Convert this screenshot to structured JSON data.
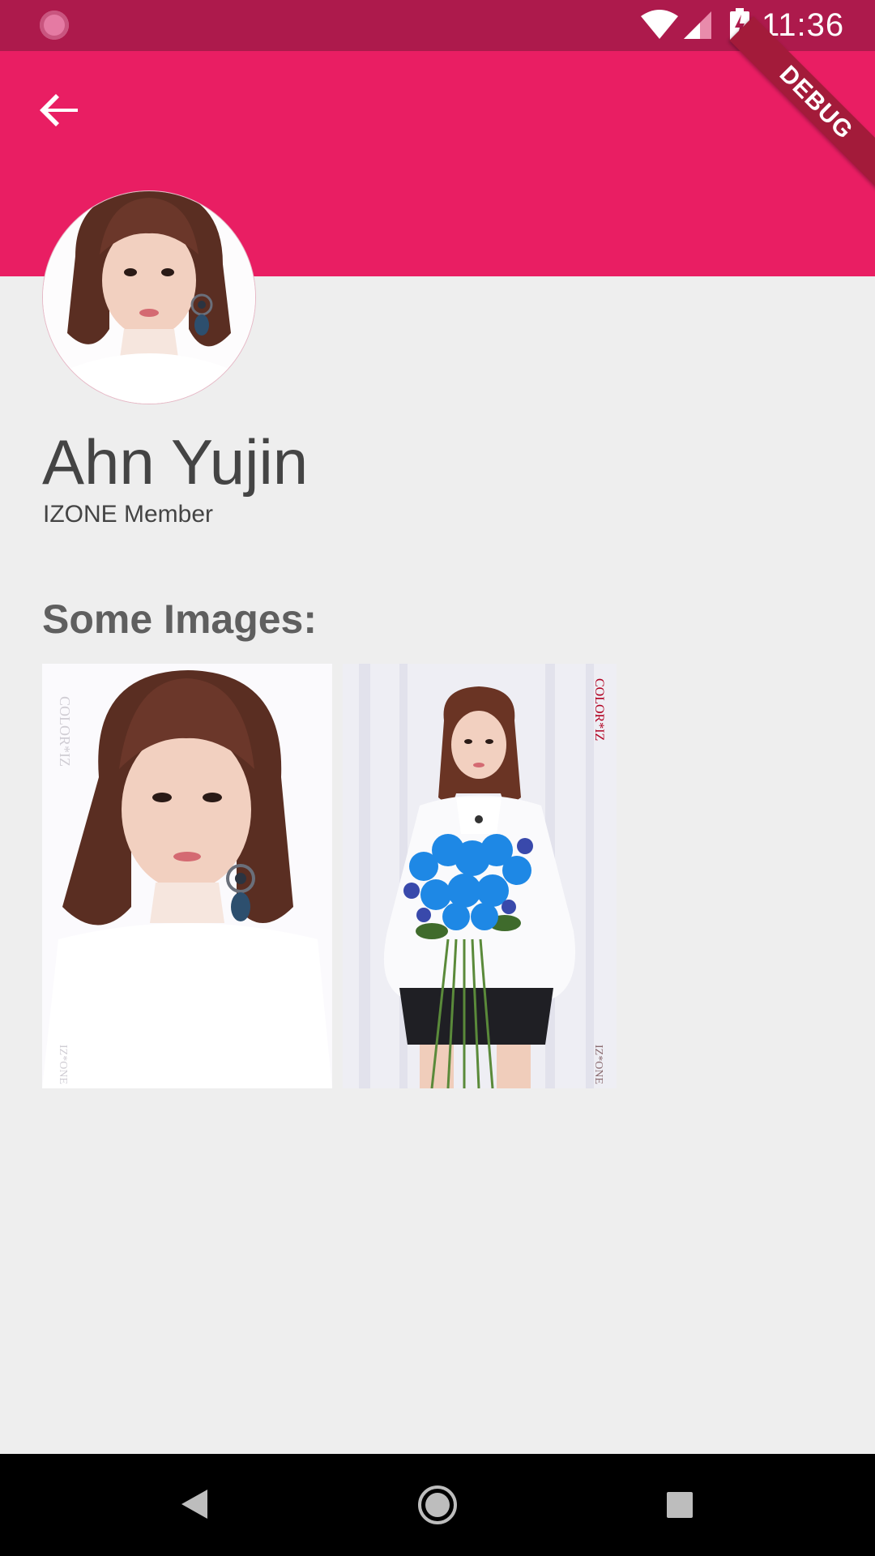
{
  "status_bar": {
    "time": "11:36",
    "icons": [
      "loading-indicator-icon",
      "wifi-icon",
      "signal-icon",
      "battery-charging-icon"
    ]
  },
  "debug_banner": {
    "label": "DEBUG"
  },
  "app_bar": {
    "color": "#e91e63",
    "back_icon": "arrow-back-icon"
  },
  "profile": {
    "name": "Ahn Yujin",
    "role": "IZONE Member"
  },
  "gallery": {
    "title": "Some Images:",
    "photos": [
      {
        "marks_top": "COLOR*IZ",
        "marks_bottom": "IZ*ONE"
      },
      {
        "marks_top": "COLOR*IZ",
        "marks_bottom": "IZ*ONE"
      }
    ]
  },
  "nav_bar": {
    "icons": [
      "nav-back-icon",
      "nav-home-icon",
      "nav-recents-icon"
    ]
  },
  "colors": {
    "status_bar": "#ad1a4c",
    "accent": "#e91e63",
    "background": "#eeeeee",
    "text_primary": "#444444",
    "text_section": "#5f5f5f"
  }
}
